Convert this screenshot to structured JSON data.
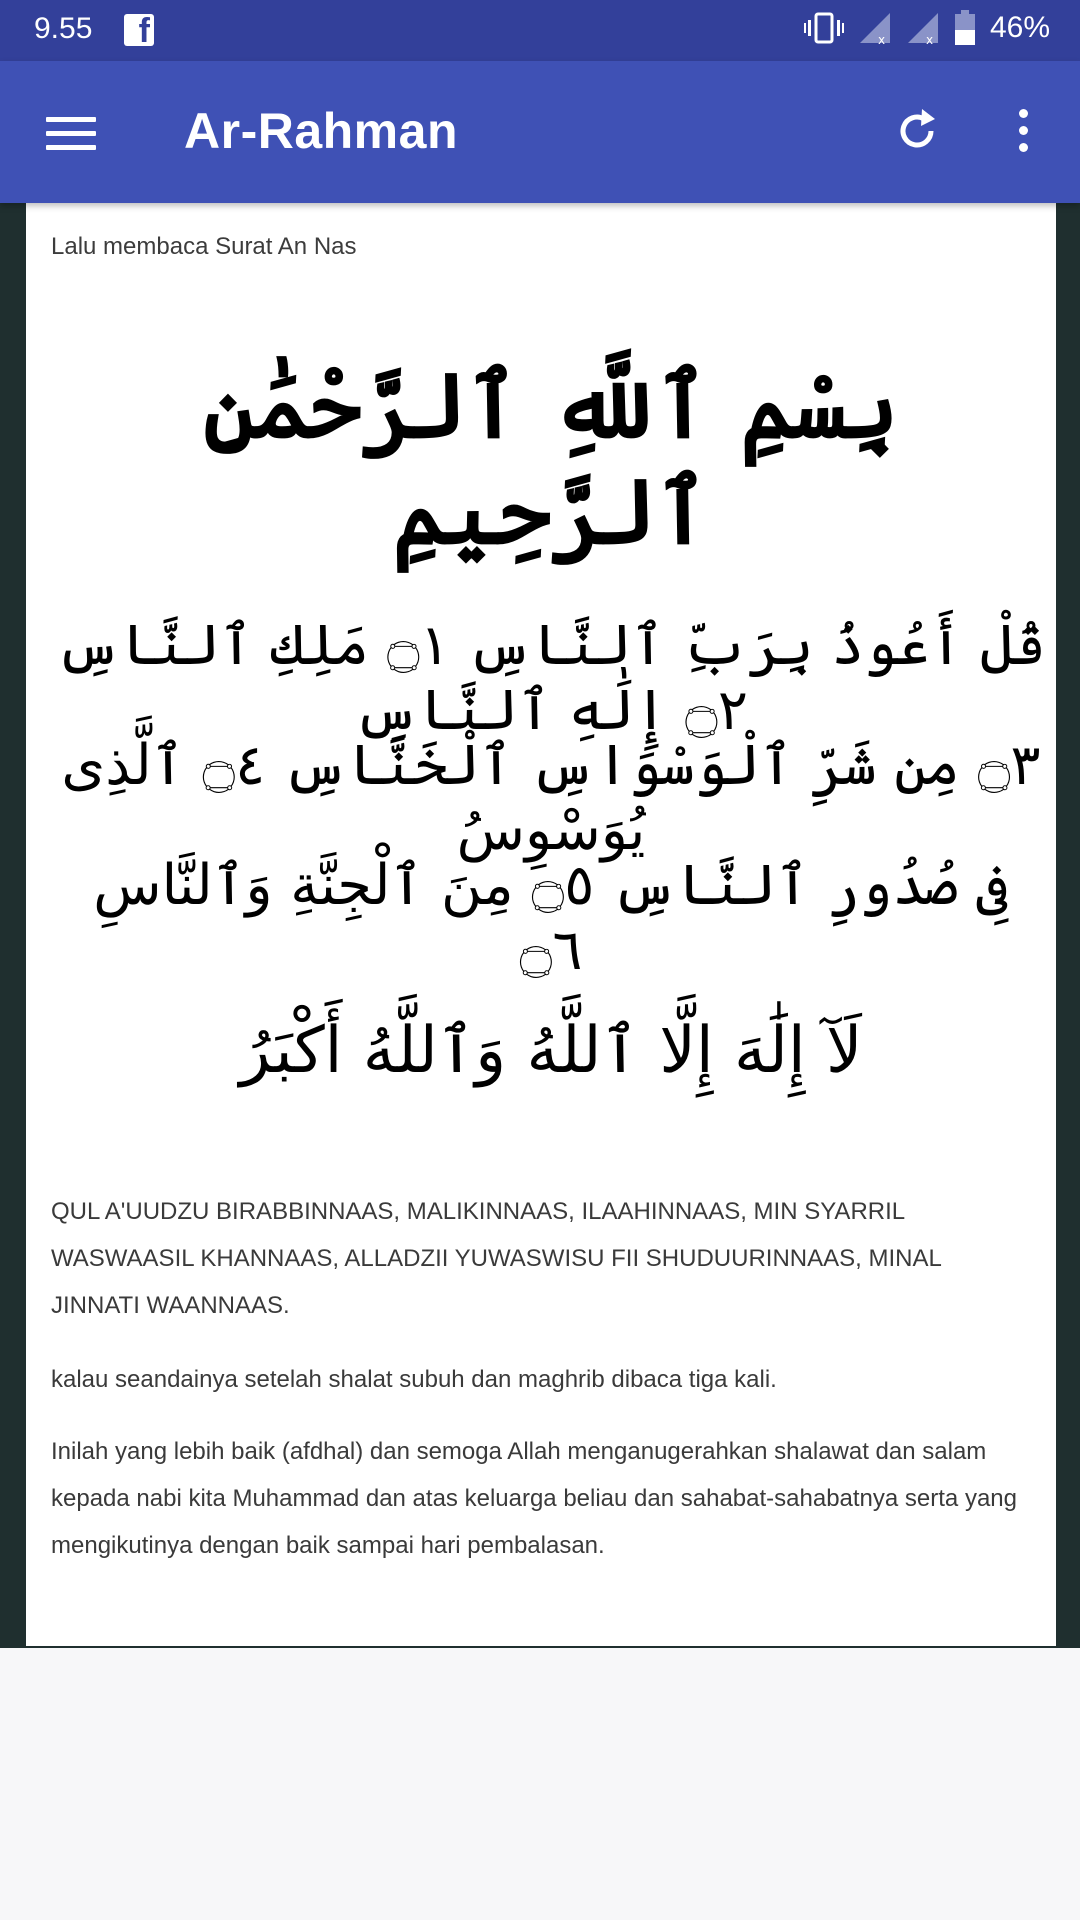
{
  "status_bar": {
    "time": "9.55",
    "notification_icon": "facebook-icon",
    "battery_percent": "46%",
    "icons": [
      "vibrate-icon",
      "signal-icon",
      "signal-icon",
      "battery-icon"
    ]
  },
  "app_bar": {
    "title": "Ar-Rahman",
    "menu_icon": "hamburger-menu-icon",
    "refresh_icon": "refresh-icon",
    "more_icon": "more-vertical-icon",
    "background_color": "#3f51b5",
    "status_color": "#33409a"
  },
  "content": {
    "intro": "Lalu membaca Surat An Nas",
    "arabic": {
      "basmala": "بِسْمِ ٱللَّهِ ٱلرَّحْمَٰنِ ٱلرَّحِيمِ",
      "ayah_lines": [
        "قُلْ أَعُوذُ بِرَبِّ ٱلنَّاسِ ۝١ مَلِكِ ٱلنَّاسِ ۝٢ إِلَٰهِ ٱلنَّاسِ",
        "۝٣ مِن شَرِّ ٱلْوَسْوَاسِ ٱلْخَنَّاسِ ۝٤ ٱلَّذِى يُوَسْوِسُ",
        "فِى صُدُورِ ٱلنَّاسِ ۝٥ مِنَ ٱلْجِنَّةِ وَٱلنَّاسِ ۝٦"
      ],
      "closing": "لَآ إِلَٰهَ إِلَّا ٱللَّهُ وَٱللَّهُ أَكْبَرُ"
    },
    "transliteration": "QUL A'UUDZU BIRABBINNAAS, MALIKINNAAS, ILAAHINNAAS, MIN SYARRIL WASWAASIL KHANNAAS, ALLADZII YUWASWISU FII SHUDUURINNAAS, MINAL JINNATI WAANNAAS.",
    "repeat_note": "kalau seandainya setelah shalat subuh dan maghrib dibaca tiga kali.",
    "closing_paragraph": "Inilah yang lebih baik (afdhal) dan semoga Allah menganugerahkan shalawat dan salam kepada nabi kita Muhammad dan atas keluarga beliau dan sahabat-sahabatnya serta yang mengikutinya dengan baik sampai hari pembalasan."
  }
}
